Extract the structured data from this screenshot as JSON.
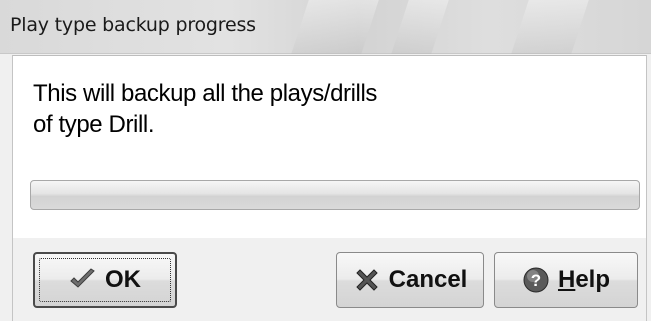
{
  "window": {
    "title": "Play type backup progress"
  },
  "message": {
    "line1": "This will backup all the plays/drills",
    "line2": "of type Drill."
  },
  "progress": {
    "fraction": 0
  },
  "buttons": {
    "ok": {
      "label": "OK",
      "icon": "checkmark-icon"
    },
    "cancel": {
      "label": "Cancel",
      "icon": "x-icon"
    },
    "help": {
      "label_first": "H",
      "label_rest": "elp",
      "icon": "question-icon"
    }
  },
  "colors": {
    "progress_fill": "#4ec24a",
    "question_icon_bg": "#4a4a4a"
  }
}
